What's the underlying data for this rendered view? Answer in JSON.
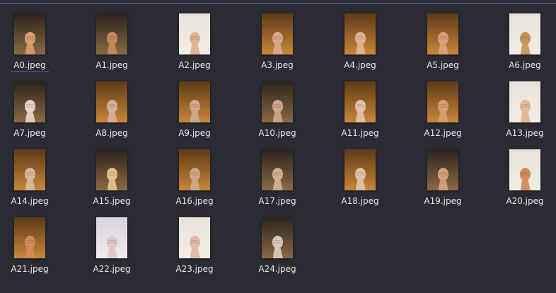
{
  "accent_color": "#5b66b8",
  "files": [
    {
      "name": "A0.jpeg",
      "selected": true,
      "scene": "dark",
      "skin": "#d59c6d"
    },
    {
      "name": "A1.jpeg",
      "scene": "dark",
      "skin": "#c68b5a"
    },
    {
      "name": "A2.jpeg",
      "scene": "light",
      "skin": "#dfb493"
    },
    {
      "name": "A3.jpeg",
      "scene": "orange",
      "skin": "#d9a98a"
    },
    {
      "name": "A4.jpeg",
      "scene": "orange",
      "skin": "#e0b492"
    },
    {
      "name": "A5.jpeg",
      "scene": "orange",
      "skin": "#d8a27a"
    },
    {
      "name": "A6.jpeg",
      "scene": "light",
      "skin": "#c8955e"
    },
    {
      "name": "A7.jpeg",
      "scene": "dark",
      "skin": "#e6d1c3"
    },
    {
      "name": "A8.jpeg",
      "scene": "orange",
      "skin": "#d7b09a"
    },
    {
      "name": "A9.jpeg",
      "scene": "orange",
      "skin": "#d0a98d"
    },
    {
      "name": "A10.jpeg",
      "scene": "dark",
      "skin": "#cfa68b"
    },
    {
      "name": "A11.jpeg",
      "scene": "orange",
      "skin": "#e2c2ab"
    },
    {
      "name": "A12.jpeg",
      "scene": "orange",
      "skin": "#d79f72"
    },
    {
      "name": "A13.jpeg",
      "scene": "light",
      "skin": "#e3b895"
    },
    {
      "name": "A14.jpeg",
      "scene": "orange",
      "skin": "#d9b59f"
    },
    {
      "name": "A15.jpeg",
      "scene": "dark",
      "skin": "#dfc08a"
    },
    {
      "name": "A16.jpeg",
      "scene": "orange",
      "skin": "#cda68a"
    },
    {
      "name": "A17.jpeg",
      "scene": "dark",
      "skin": "#d3ad95"
    },
    {
      "name": "A18.jpeg",
      "scene": "orange",
      "skin": "#e0c0a6"
    },
    {
      "name": "A19.jpeg",
      "scene": "dark",
      "skin": "#d3a17a"
    },
    {
      "name": "A20.jpeg",
      "scene": "light",
      "skin": "#d38f57"
    },
    {
      "name": "A21.jpeg",
      "scene": "orange",
      "skin": "#d28a55"
    },
    {
      "name": "A22.jpeg",
      "scene": "pale",
      "skin": "#e3c6c7"
    },
    {
      "name": "A23.jpeg",
      "scene": "light",
      "skin": "#e2b8a8"
    },
    {
      "name": "A24.jpeg",
      "scene": "dark",
      "skin": "#d9c7b8"
    }
  ]
}
